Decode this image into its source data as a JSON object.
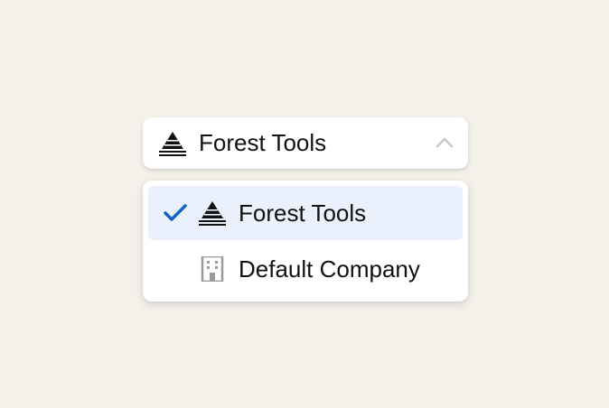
{
  "select": {
    "selected_label": "Forest Tools",
    "selected_icon": "forest-tools-logo-icon",
    "expanded": true
  },
  "options": [
    {
      "label": "Forest Tools",
      "icon": "forest-tools-logo-icon",
      "selected": true
    },
    {
      "label": "Default Company",
      "icon": "building-icon",
      "selected": false
    }
  ],
  "colors": {
    "background": "#f4f0ea",
    "selected_option_bg": "#eaf1fd",
    "checkmark": "#1565c0",
    "chevron": "#c8c8c8",
    "building_icon": "#9a9a9a"
  }
}
